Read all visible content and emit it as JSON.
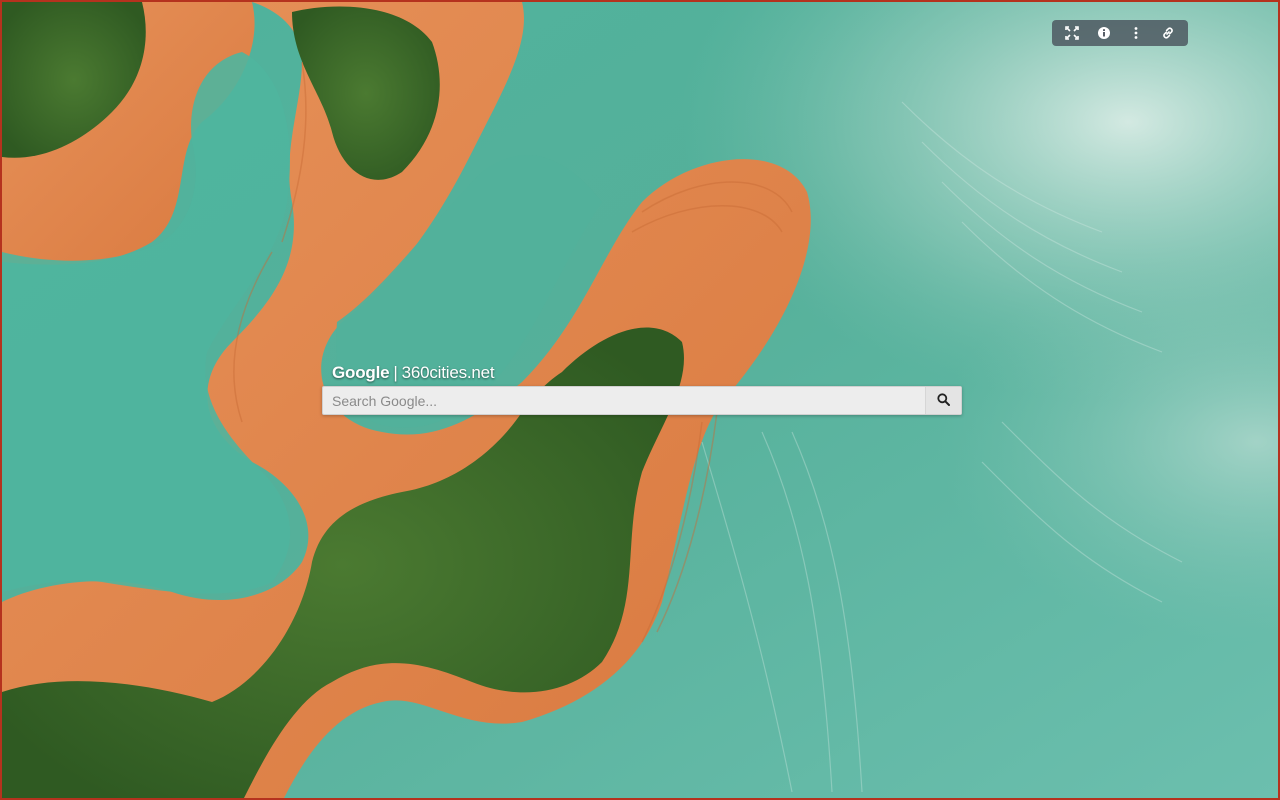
{
  "brand": {
    "name": "Google",
    "separator": "|",
    "source": "360cities.net"
  },
  "search": {
    "placeholder": "Search Google...",
    "value": "",
    "button_icon": "search-icon"
  },
  "toolbar": {
    "buttons": [
      {
        "icon": "fullscreen-icon"
      },
      {
        "icon": "info-icon"
      },
      {
        "icon": "more-vertical-icon"
      },
      {
        "icon": "link-icon"
      }
    ]
  },
  "colors": {
    "frame_border": "#b5321e",
    "water": "#5bb3a0",
    "land_clay": "#e08a4e",
    "vegetation": "#3f6b2a",
    "toolbar_bg": "#464e58"
  }
}
